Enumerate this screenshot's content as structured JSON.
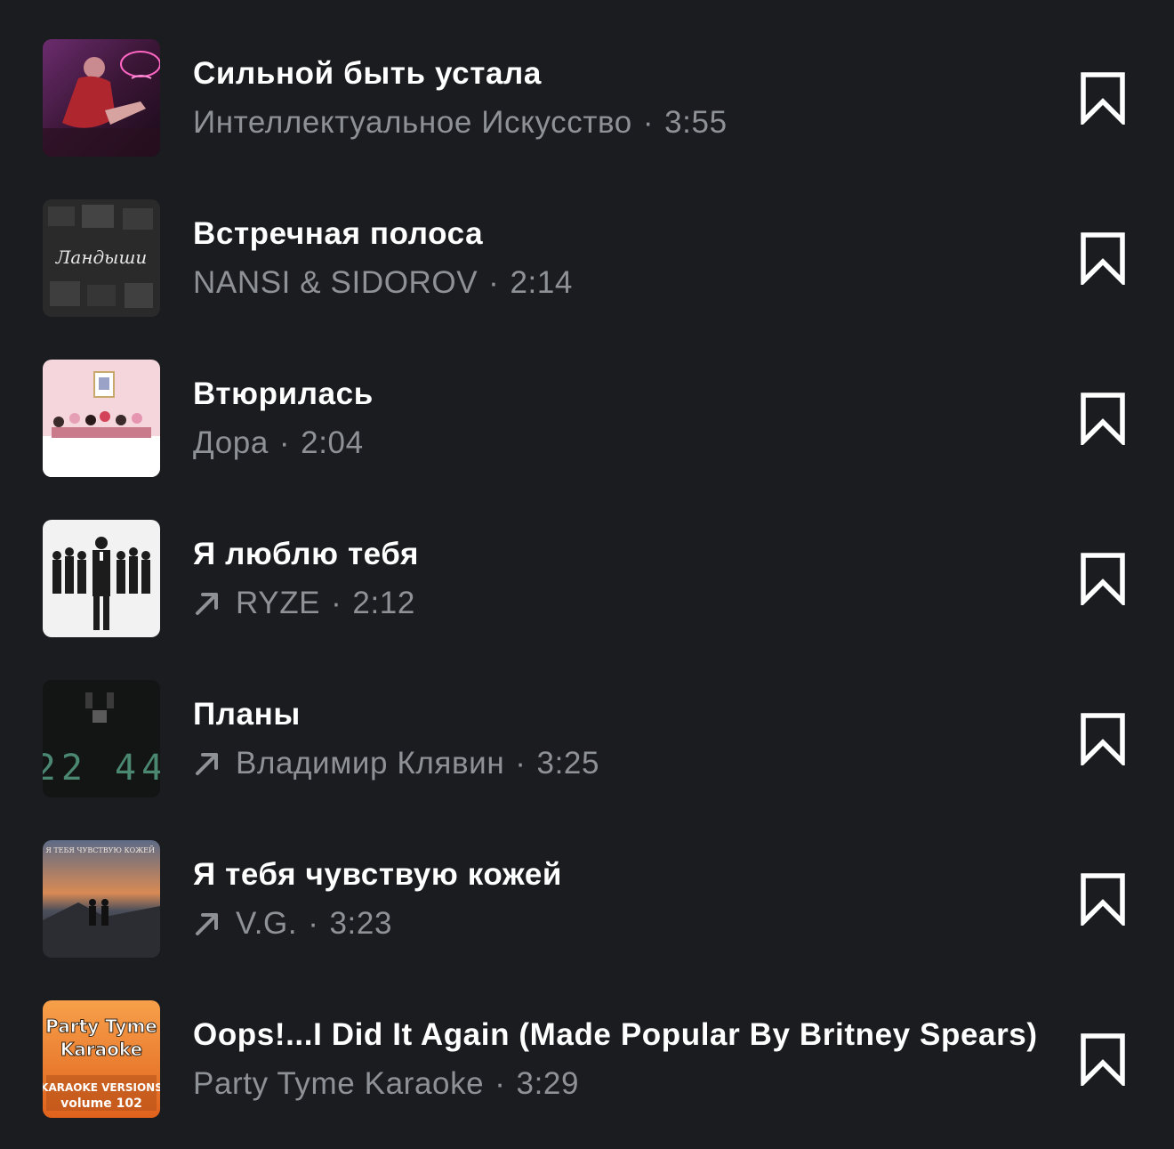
{
  "tracks": [
    {
      "title": "Сильной быть устала",
      "artist": "Интеллектуальное Искусство",
      "duration": "3:55",
      "trending": false,
      "cover": "woman-in-neon-room"
    },
    {
      "title": "Встречная полоса",
      "artist": "NANSI & SIDOROV",
      "duration": "2:14",
      "trending": false,
      "cover": "landyshi-dark-collage",
      "cover_text": "Ландыши"
    },
    {
      "title": "Втюрилась",
      "artist": "Дора",
      "duration": "2:04",
      "trending": false,
      "cover": "pink-banquet-table"
    },
    {
      "title": "Я люблю тебя",
      "artist": "RYZE",
      "duration": "2:12",
      "trending": true,
      "cover": "man-in-suit-with-choir"
    },
    {
      "title": "Планы",
      "artist": "Владимир Клявин",
      "duration": "3:25",
      "trending": true,
      "cover": "digital-clock-22-44",
      "cover_text": "22 44"
    },
    {
      "title": "Я тебя чувствую кожей",
      "artist": "V.G.",
      "duration": "3:23",
      "trending": true,
      "cover": "couple-on-cliff-sunset",
      "cover_text": "Я ТЕБЯ ЧУВСТВУЮ КОЖЕЙ"
    },
    {
      "title": "Oops!...I Did It Again (Made Popular By Britney Spears)",
      "artist": "Party Tyme Karaoke",
      "duration": "3:29",
      "trending": false,
      "cover": "party-tyme-karaoke-orange",
      "cover_text": [
        "Party Tyme",
        "Karaoke",
        "KARAOKE VERSIONS",
        "volume 102"
      ]
    }
  ],
  "separator": "·",
  "colors": {
    "background": "#1a1c20",
    "title": "#ffffff",
    "subtitle": "#8e9196"
  },
  "icons": {
    "bookmark": "bookmark-icon",
    "trend": "trend-up-arrow-icon"
  }
}
